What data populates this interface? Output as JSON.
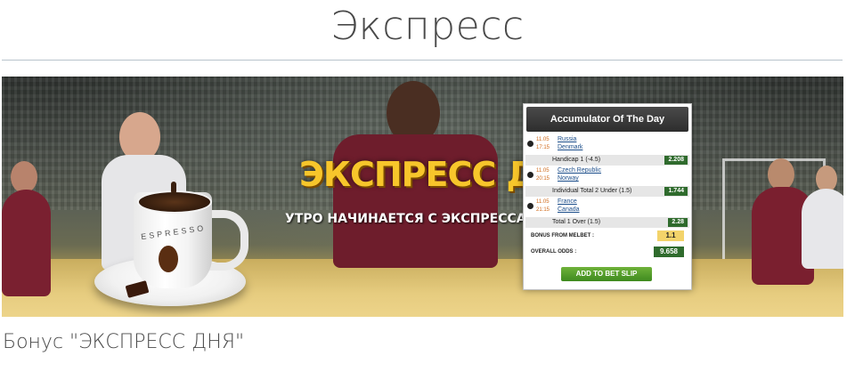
{
  "page": {
    "title": "Экспресс",
    "section_heading": "Бонус \"ЭКСПРЕСС ДНЯ\""
  },
  "banner": {
    "headline": "ЭКСПРЕСС ДНЯ",
    "subheadline": "УТРО НАЧИНАЕТСЯ С ЭКСПРЕССА",
    "cup_label": "ESPRESSO",
    "colors": {
      "headline": "#f7c62b",
      "card_header": "#2d2d2d",
      "odds_green": "#2f6b2d",
      "bonus_yellow": "#f3d36a",
      "button_green": "#4f9c2a"
    }
  },
  "accumulator": {
    "title": "Accumulator Of The Day",
    "matches": [
      {
        "date": "11.05",
        "time": "17:15",
        "team1": "Russia",
        "team2": "Denmark",
        "market": "Handicap 1 (-4.5)",
        "odd": "2.208"
      },
      {
        "date": "11.05",
        "time": "20:15",
        "team1": "Czech Republic",
        "team2": "Norway",
        "market": "Individual Total 2 Under (1.5)",
        "odd": "1.744"
      },
      {
        "date": "11.05",
        "time": "21:15",
        "team1": "France",
        "team2": "Canada",
        "market": "Total 1 Over (1.5)",
        "odd": "2.28"
      }
    ],
    "bonus_label": "BONUS FROM MELBET :",
    "bonus_value": "1.1",
    "overall_label": "OVERALL ODDS :",
    "overall_value": "9.658",
    "button_label": "ADD TO BET SLIP"
  }
}
